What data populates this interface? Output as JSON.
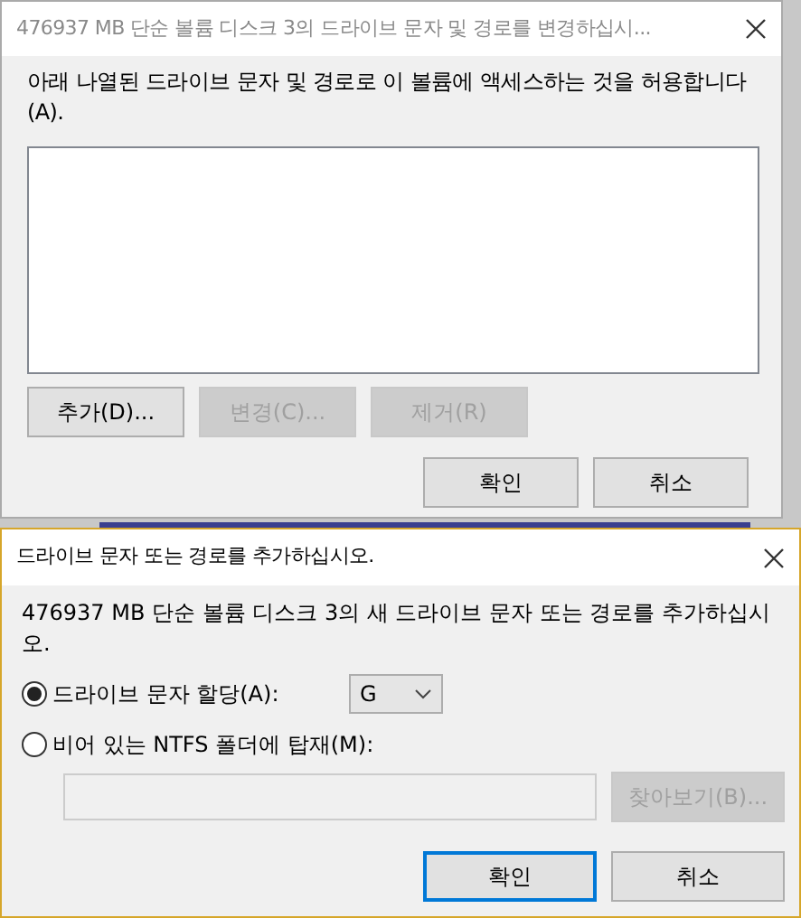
{
  "back_dialog": {
    "title": "476937 MB  단순 볼륨 디스크 3의 드라이브 문자 및 경로를 변경하십시...",
    "active": false,
    "description": "아래 나열된 드라이브 문자 및 경로로 이 볼륨에 액세스하는 것을 허용합니다(A).",
    "path_buttons": [
      {
        "label": "추가(D)...",
        "disabled": false
      },
      {
        "label": "변경(C)...",
        "disabled": true
      },
      {
        "label": "제거(R)",
        "disabled": true
      }
    ],
    "dialog_buttons": [
      {
        "label": "확인",
        "focused": false
      },
      {
        "label": "취소",
        "focused": false
      }
    ]
  },
  "front_dialog": {
    "title": "드라이브 문자 또는 경로를 추가하십시오.",
    "active": true,
    "description": "476937 MB  단순 볼륨 디스크 3의 새 드라이브 문자 또는 경로를 추가하십시오.",
    "options": [
      {
        "kind": "letter",
        "label": "드라이브 문자 할당(A):",
        "selected": true,
        "value": "G"
      },
      {
        "kind": "folder",
        "label": "비어 있는 NTFS 폴더에 탑재(M):",
        "selected": false,
        "browse_button": {
          "label": "찾아보기(B)...",
          "disabled": true
        }
      }
    ],
    "dialog_buttons": [
      {
        "label": "확인",
        "focused": true
      },
      {
        "label": "취소",
        "focused": false
      }
    ]
  }
}
